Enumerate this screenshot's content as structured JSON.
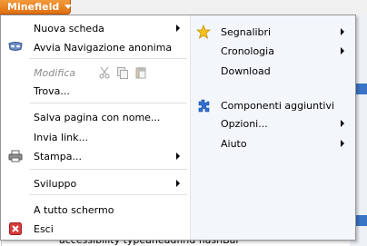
{
  "app_button": {
    "label": "Minefield"
  },
  "menu": {
    "left": [
      {
        "label": "Nuova scheda",
        "submenu": true
      },
      {
        "label": "Avvia Navigazione anonima",
        "submenu": false
      },
      {
        "label": "Modifica",
        "disabled": true
      },
      {
        "label": "Trova...",
        "submenu": false
      },
      {
        "label": "Salva pagina con nome...",
        "submenu": false
      },
      {
        "label": "Invia link...",
        "submenu": false
      },
      {
        "label": "Stampa...",
        "submenu": true
      },
      {
        "label": "Sviluppo",
        "submenu": true
      },
      {
        "label": "A tutto schermo",
        "submenu": false
      },
      {
        "label": "Esci",
        "submenu": false
      }
    ],
    "right": [
      {
        "label": "Segnalibri",
        "submenu": true,
        "icon": "star-icon"
      },
      {
        "label": "Cronologia",
        "submenu": true
      },
      {
        "label": "Download",
        "submenu": false
      },
      {
        "label": "Componenti aggiuntivi",
        "submenu": false,
        "icon": "puzzle-icon"
      },
      {
        "label": "Opzioni...",
        "submenu": true
      },
      {
        "label": "Aiuto",
        "submenu": true
      }
    ]
  },
  "background": {
    "bottom_text": "accessibility typeaheadfind flashBar"
  },
  "colors": {
    "accent_orange": "#e0700e",
    "exit_red": "#d83b3b",
    "star_yellow": "#f6c21c",
    "puzzle_blue": "#2f6fd1"
  }
}
